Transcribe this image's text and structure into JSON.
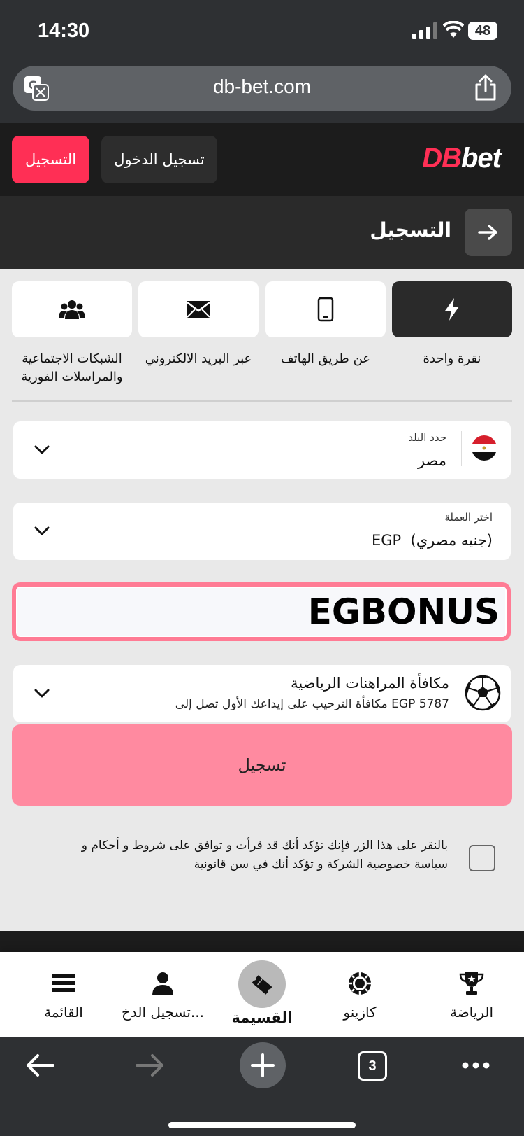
{
  "status_bar": {
    "time": "14:30",
    "battery": "48"
  },
  "browser": {
    "url": "db-bet.com",
    "tab_count": "3"
  },
  "header": {
    "logo_db": "DB",
    "logo_bet": "bet",
    "register_label": "التسجيل",
    "login_label": "تسجيل الدخول"
  },
  "page": {
    "title": "التسجيل"
  },
  "methods": [
    {
      "label": "نقرة واحدة",
      "icon": "lightning-icon",
      "active": true
    },
    {
      "label": "عن طريق الهاتف",
      "icon": "phone-icon",
      "active": false
    },
    {
      "label": "عبر البريد الالكتروني",
      "icon": "mail-icon",
      "active": false
    },
    {
      "label_line1": "الشبكات الاجتماعية",
      "label_line2": "والمراسلات الفورية",
      "icon": "users-icon",
      "active": false
    }
  ],
  "country": {
    "label": "حدد البلد",
    "value": "مصر"
  },
  "currency": {
    "label": "اختر العملة",
    "value": "EGP  (جنيه مصري)"
  },
  "promo_code": {
    "value": "EGBONUS"
  },
  "bonus": {
    "title": "مكافأة المراهنات الرياضية",
    "subtitle": "مكافأة الترحيب على إيداعك الأول تصل إلى EGP 5787"
  },
  "submit_label": "تسجيل",
  "terms": {
    "part1": "بالنقر على هذا الزر فإنك تؤكد أنك قد قرأت و توافق على ",
    "link1": "شروط و أحكام",
    "part2": " و ",
    "link2": "سياسة خصوصية",
    "part3": " الشركة و تؤكد أنك في سن قانونية"
  },
  "bottom_nav": [
    {
      "label": "الرياضة",
      "icon": "trophy-icon"
    },
    {
      "label": "كازينو",
      "icon": "casino-chip-icon"
    },
    {
      "label": "القسيمة",
      "icon": "ticket-icon"
    },
    {
      "label": "تسجيل الدخ...",
      "icon": "user-icon"
    },
    {
      "label": "القائمة",
      "icon": "menu-icon"
    }
  ],
  "colors": {
    "accent": "#ff2f55",
    "submit_bg": "#ff8aa0",
    "promo_border": "#ff7b94"
  }
}
